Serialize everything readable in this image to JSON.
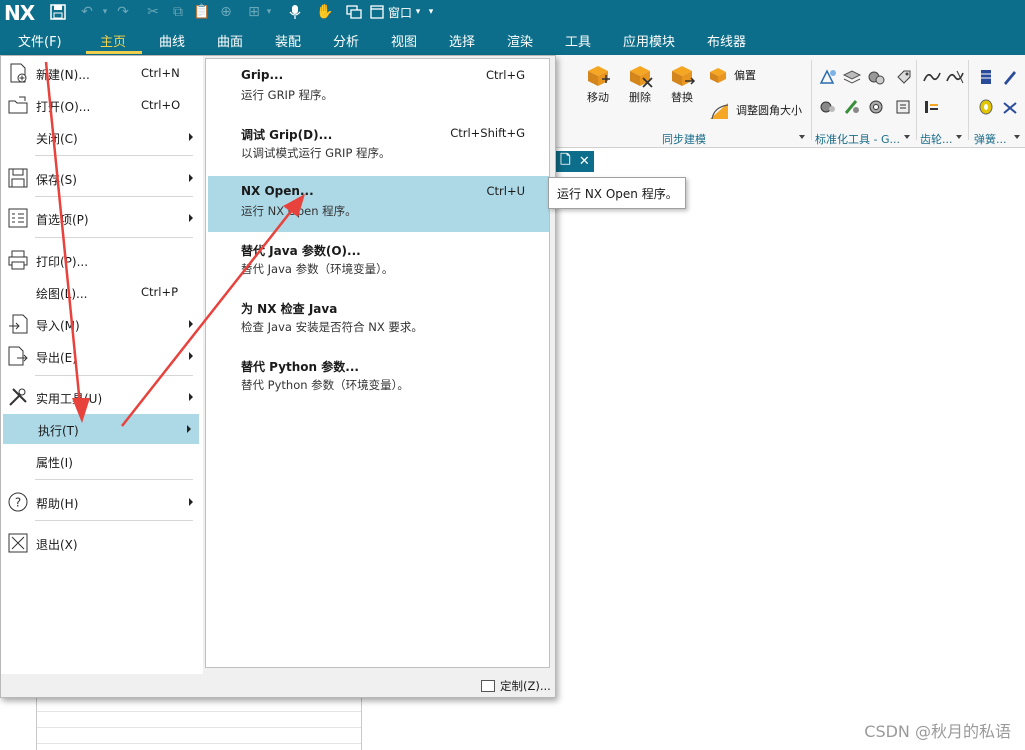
{
  "app": {
    "logo": "NX",
    "window_menu": "窗口"
  },
  "ribbon_tabs": [
    "文件(F)",
    "主页",
    "曲线",
    "曲面",
    "装配",
    "分析",
    "视图",
    "选择",
    "渲染",
    "工具",
    "应用模块",
    "布线器"
  ],
  "ribbon": {
    "move": "移动",
    "delete": "删除",
    "replace": "替换",
    "offset": "偏置",
    "resize_fillet": "调整圆角大小",
    "group_sync": "同步建模",
    "group_standard": "标准化工具 - G...",
    "group_gear": "齿轮...",
    "group_spring": "弹簧..."
  },
  "file_menu": {
    "new": {
      "label": "新建(N)...",
      "shortcut": "Ctrl+N"
    },
    "open": {
      "label": "打开(O)...",
      "shortcut": "Ctrl+O"
    },
    "close": {
      "label": "关闭(C)"
    },
    "save": {
      "label": "保存(S)"
    },
    "prefs": {
      "label": "首选项(P)"
    },
    "print": {
      "label": "打印(P)..."
    },
    "plot": {
      "label": "绘图(L)...",
      "shortcut": "Ctrl+P"
    },
    "import": {
      "label": "导入(M)"
    },
    "export": {
      "label": "导出(E)"
    },
    "utilities": {
      "label": "实用工具(U)"
    },
    "execute": {
      "label": "执行(T)"
    },
    "properties": {
      "label": "属性(I)"
    },
    "help": {
      "label": "帮助(H)"
    },
    "exit": {
      "label": "退出(X)"
    }
  },
  "execute_submenu": [
    {
      "title": "Grip...",
      "shortcut": "Ctrl+G",
      "desc": "运行 GRIP 程序。"
    },
    {
      "title": "调试 Grip(D)...",
      "shortcut": "Ctrl+Shift+G",
      "desc": "以调试模式运行 GRIP 程序。"
    },
    {
      "title": "NX Open...",
      "shortcut": "Ctrl+U",
      "desc": "运行 NX Open 程序。"
    },
    {
      "title": "替代 Java 参数(O)...",
      "shortcut": "",
      "desc": "替代 Java 参数（环境变量）。"
    },
    {
      "title": "为 NX 检查 Java",
      "shortcut": "",
      "desc": "检查 Java 安装是否符合 NX 要求。"
    },
    {
      "title": "替代 Python 参数...",
      "shortcut": "",
      "desc": "替代 Python 参数（环境变量）。"
    }
  ],
  "customize": "定制(Z)...",
  "tooltip": "运行 NX Open 程序。",
  "watermark": "CSDN @秋月的私语",
  "colors": {
    "brand": "#0c6e8a",
    "highlight": "#add8e6",
    "active_tab": "#f3d24e",
    "arrow": "#e8423d"
  }
}
